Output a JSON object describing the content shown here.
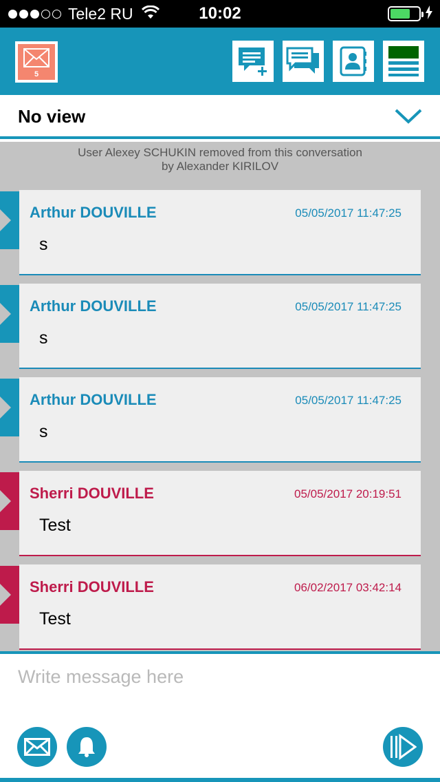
{
  "status_bar": {
    "carrier": "Tele2 RU",
    "time": "10:02",
    "signal_bars_filled": 3,
    "signal_bars_total": 5
  },
  "toolbar": {
    "unread_count": "5",
    "icons": [
      "mail-icon",
      "new-message-icon",
      "conversations-icon",
      "contacts-icon",
      "menu-icon"
    ]
  },
  "view": {
    "title": "No view"
  },
  "conversation": {
    "system_message_line1": "User Alexey SCHUKIN removed from this conversation",
    "system_message_line2": "by Alexander KIRILOV",
    "messages": [
      {
        "author": "Arthur DOUVILLE",
        "time": "05/05/2017 11:47:25",
        "text": "s"
      },
      {
        "author": "Arthur DOUVILLE",
        "time": "05/05/2017 11:47:25",
        "text": "s"
      },
      {
        "author": "Arthur DOUVILLE",
        "time": "05/05/2017 11:47:25",
        "text": "s"
      },
      {
        "author": "Sherri DOUVILLE",
        "time": "05/05/2017 20:19:51",
        "text": "Test"
      },
      {
        "author": "Sherri DOUVILLE",
        "time": "06/02/2017 03:42:14",
        "text": "Test"
      }
    ]
  },
  "compose": {
    "placeholder": "Write message here"
  },
  "colors": {
    "brand": "#1795b9",
    "arthur": "#1a8bb8",
    "sherri": "#be1b4b",
    "mail_badge": "#f4866f",
    "menu_accent": "#006400"
  }
}
